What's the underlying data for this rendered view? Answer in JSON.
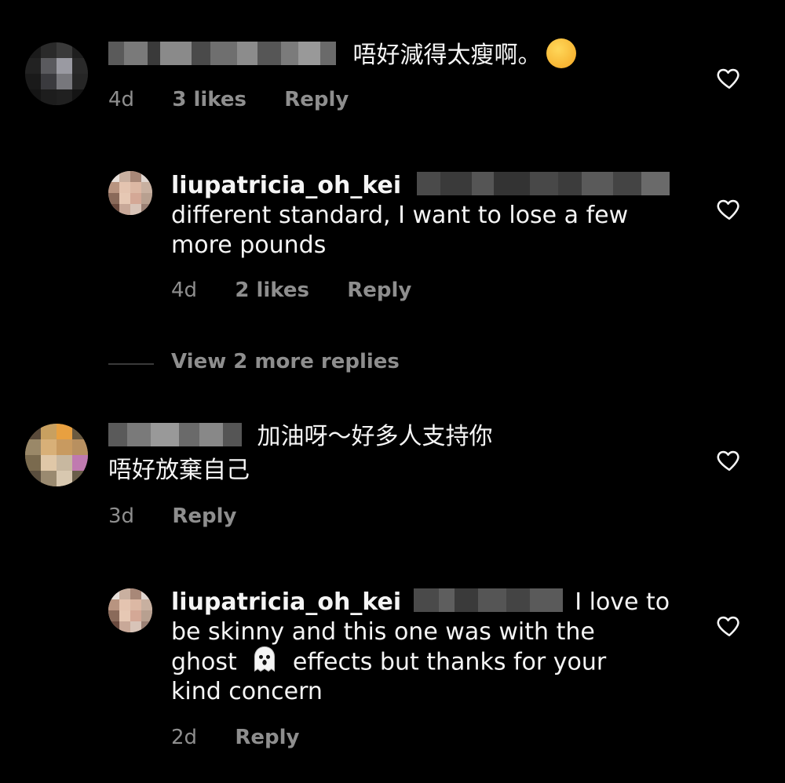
{
  "comments": [
    {
      "text": "唔好減得太瘦啊。",
      "emoji": "smiling-face-emoji",
      "time": "4d",
      "likes": "3 likes",
      "reply": "Reply"
    },
    {
      "username": "liupatricia_oh_kei",
      "text_line1": "different standard, I want to lose a few",
      "text_line2": "more pounds",
      "time": "4d",
      "likes": "2 likes",
      "reply": "Reply"
    },
    {
      "view_more": "View 2 more replies"
    },
    {
      "text_line1": "加油呀～好多人支持你",
      "text_line2": "唔好放棄自己",
      "time": "3d",
      "reply": "Reply"
    },
    {
      "username": "liupatricia_oh_kei",
      "text_line1_tail": "I love to",
      "text_line2": "be skinny and this one was with the",
      "text_line3_pre": "ghost",
      "emoji": "ghost-emoji",
      "text_line3_post": "effects but thanks for your",
      "text_line4": "kind concern",
      "time": "2d",
      "reply": "Reply"
    }
  ],
  "colors": {
    "background": "#000000",
    "text": "#f5f5f5",
    "meta": "#8e8e8e"
  }
}
